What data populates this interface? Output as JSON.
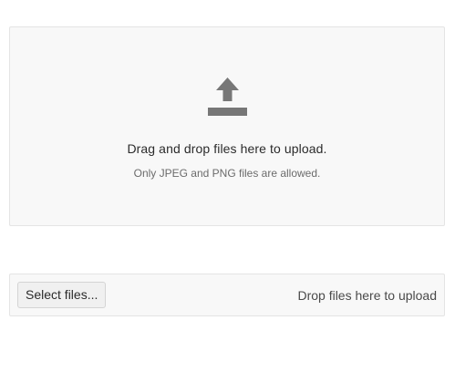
{
  "dropzone": {
    "icon": "upload-icon",
    "title": "Drag and drop files here to upload.",
    "hint": "Only JPEG and PNG files are allowed."
  },
  "upload_bar": {
    "select_button_label": "Select files...",
    "drop_label": "Drop files here to upload"
  },
  "colors": {
    "icon": "#777777",
    "panel_background": "#f8f8f8",
    "panel_border": "#e4e4e4"
  }
}
